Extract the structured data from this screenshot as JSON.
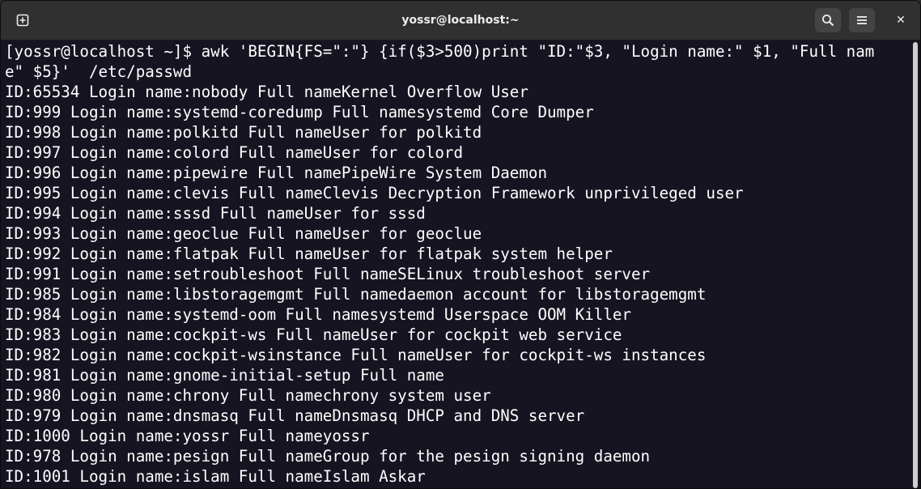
{
  "window": {
    "title": "yossr@localhost:~"
  },
  "titlebar": {
    "new_tab_icon": "new-tab-icon",
    "search_icon": "search-icon",
    "menu_icon": "hamburger-menu-icon",
    "close_label": "✕"
  },
  "terminal": {
    "lines": [
      "[yossr@localhost ~]$ awk 'BEGIN{FS=\":\"} {if($3>500)print \"ID:\"$3, \"Login name:\" $1, \"Full nam",
      "e\" $5}'  /etc/passwd",
      "ID:65534 Login name:nobody Full nameKernel Overflow User",
      "ID:999 Login name:systemd-coredump Full namesystemd Core Dumper",
      "ID:998 Login name:polkitd Full nameUser for polkitd",
      "ID:997 Login name:colord Full nameUser for colord",
      "ID:996 Login name:pipewire Full namePipeWire System Daemon",
      "ID:995 Login name:clevis Full nameClevis Decryption Framework unprivileged user",
      "ID:994 Login name:sssd Full nameUser for sssd",
      "ID:993 Login name:geoclue Full nameUser for geoclue",
      "ID:992 Login name:flatpak Full nameUser for flatpak system helper",
      "ID:991 Login name:setroubleshoot Full nameSELinux troubleshoot server",
      "ID:985 Login name:libstoragemgmt Full namedaemon account for libstoragemgmt",
      "ID:984 Login name:systemd-oom Full namesystemd Userspace OOM Killer",
      "ID:983 Login name:cockpit-ws Full nameUser for cockpit web service",
      "ID:982 Login name:cockpit-wsinstance Full nameUser for cockpit-ws instances",
      "ID:981 Login name:gnome-initial-setup Full name",
      "ID:980 Login name:chrony Full namechrony system user",
      "ID:979 Login name:dnsmasq Full nameDnsmasq DHCP and DNS server",
      "ID:1000 Login name:yossr Full nameyossr",
      "ID:978 Login name:pesign Full nameGroup for the pesign signing daemon",
      "ID:1001 Login name:islam Full nameIslam Askar"
    ]
  },
  "colors": {
    "terminal_bg": "#171421",
    "terminal_fg": "#ffffff",
    "titlebar_bg": "#303030"
  }
}
